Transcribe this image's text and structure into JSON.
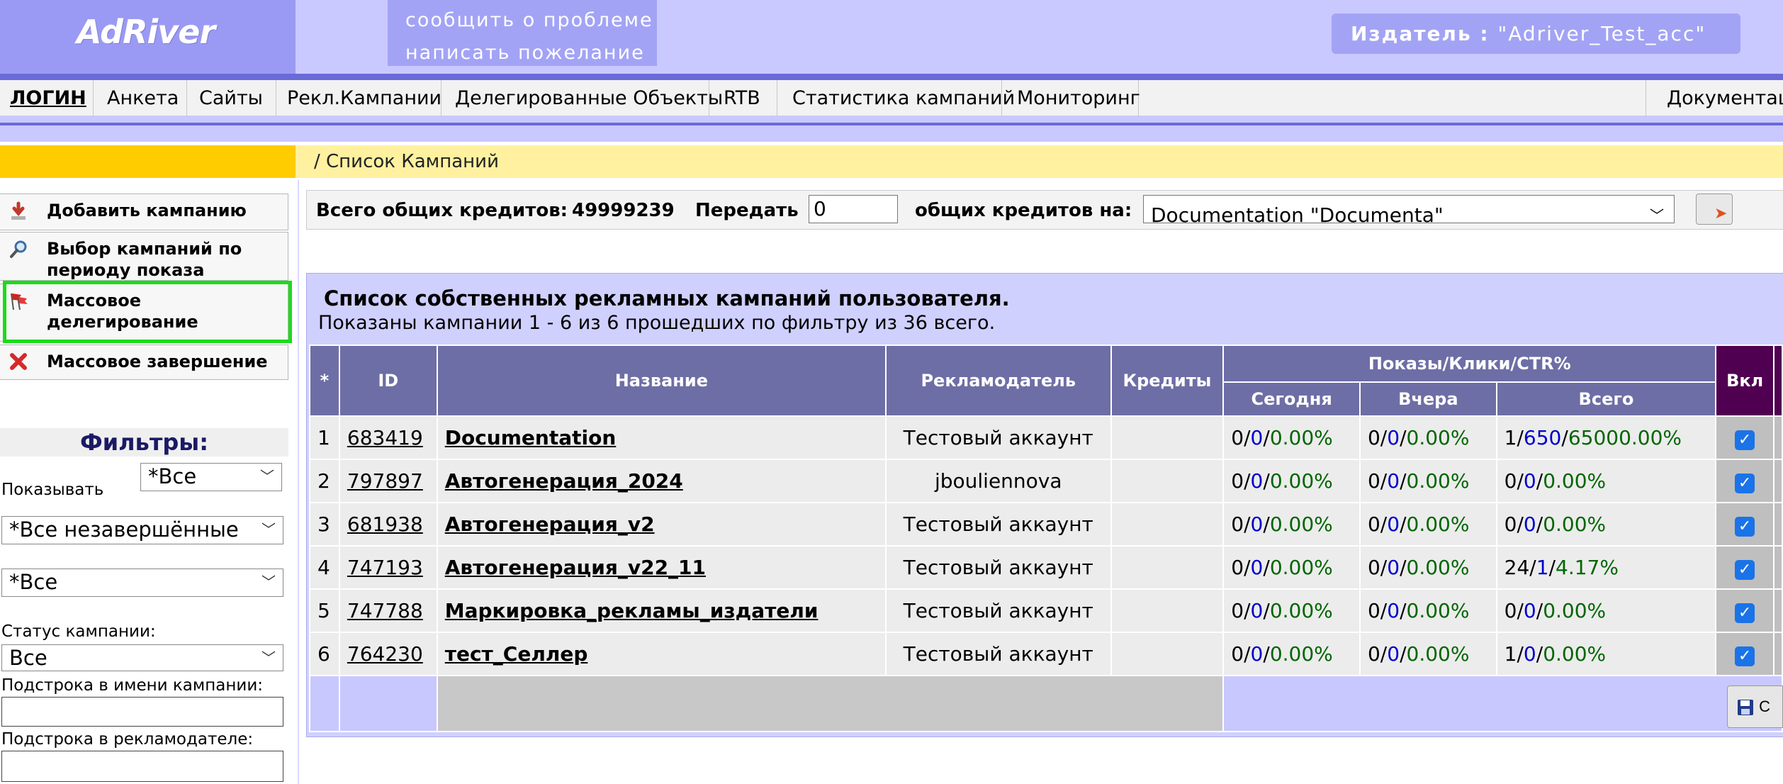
{
  "header": {
    "logo": "AdRiver",
    "feedback": [
      "сообщить о проблеме",
      "написать пожелание"
    ],
    "publisher_label": "Издатель  :",
    "publisher_value": "\"Adriver_Test_acc\""
  },
  "nav": {
    "items": [
      "ЛОГИН",
      "Анкета",
      "Сайты",
      "Рекл.Кампании",
      "Делегированные Объекты",
      "RTB",
      "Статистика кампаний",
      "Мониторинг"
    ],
    "right": "Документаци"
  },
  "breadcrumb": "/ Список Кампаний",
  "sidebar": {
    "buttons": [
      {
        "label": "Добавить кампанию",
        "icon": "download-arrow-icon"
      },
      {
        "label": "Выбор кампаний по периоду показа",
        "icon": "magnifier-icon"
      },
      {
        "label": "Массовое делегирование",
        "icon": "flags-icon"
      },
      {
        "label": "Массовое завершение",
        "icon": "red-x-icon"
      }
    ],
    "filters": {
      "title": "Фильтры:",
      "show_label": "Показывать",
      "show_value": "*Все",
      "state_value": "*Все незавершённые",
      "type_value": "*Все",
      "status_label": "Статус кампании:",
      "status_value": "Все",
      "name_substring_label": "Подстрока в имени кампании:",
      "name_substring_value": "",
      "advertiser_substring_label": "Подстрока в рекламодателе:",
      "advertiser_substring_value": ""
    }
  },
  "credits": {
    "total_label": "Всего общих кредитов:",
    "total_value": "49999239",
    "transfer_label": "Передать",
    "transfer_value": "0",
    "to_label": "общих кредитов  на:",
    "target_value": "Documentation \"Documenta\""
  },
  "campaigns": {
    "title": "Список собственных рекламных кампаний пользователя.",
    "subtitle": "Показаны кампании 1 - 6 из 6 прошедших по фильтру из 36 всего.",
    "columns": {
      "star": "*",
      "id": "ID",
      "name": "Название",
      "advertiser": "Рекламодатель",
      "credits": "Кредиты",
      "stats": "Показы/Клики/CTR%",
      "today": "Сегодня",
      "yesterday": "Вчера",
      "total": "Всего",
      "enabled": "Вкл"
    },
    "rows": [
      {
        "n": "1",
        "id": "683419",
        "name": "Documentation",
        "advertiser": "Тестовый аккаунт",
        "credits": "",
        "today": [
          "0",
          "0",
          "0.00%"
        ],
        "yesterday": [
          "0",
          "0",
          "0.00%"
        ],
        "total": [
          "1",
          "650",
          "65000.00%"
        ],
        "enabled": true
      },
      {
        "n": "2",
        "id": "797897",
        "name": "Автогенерация_2024",
        "advertiser": "jbouliennova",
        "credits": "",
        "today": [
          "0",
          "0",
          "0.00%"
        ],
        "yesterday": [
          "0",
          "0",
          "0.00%"
        ],
        "total": [
          "0",
          "0",
          "0.00%"
        ],
        "enabled": true
      },
      {
        "n": "3",
        "id": "681938",
        "name": "Автогенерация_v2",
        "advertiser": "Тестовый аккаунт",
        "credits": "",
        "today": [
          "0",
          "0",
          "0.00%"
        ],
        "yesterday": [
          "0",
          "0",
          "0.00%"
        ],
        "total": [
          "0",
          "0",
          "0.00%"
        ],
        "enabled": true
      },
      {
        "n": "4",
        "id": "747193",
        "name": "Автогенерация_v22_11",
        "advertiser": "Тестовый аккаунт",
        "credits": "",
        "today": [
          "0",
          "0",
          "0.00%"
        ],
        "yesterday": [
          "0",
          "0",
          "0.00%"
        ],
        "total": [
          "24",
          "1",
          "4.17%"
        ],
        "enabled": true
      },
      {
        "n": "5",
        "id": "747788",
        "name": "Маркировка_рекламы_издатели",
        "advertiser": "Тестовый аккаунт",
        "credits": "",
        "today": [
          "0",
          "0",
          "0.00%"
        ],
        "yesterday": [
          "0",
          "0",
          "0.00%"
        ],
        "total": [
          "0",
          "0",
          "0.00%"
        ],
        "enabled": true
      },
      {
        "n": "6",
        "id": "764230",
        "name": "тест_Селлер",
        "advertiser": "Тестовый аккаунт",
        "credits": "",
        "today": [
          "0",
          "0",
          "0.00%"
        ],
        "yesterday": [
          "0",
          "0",
          "0.00%"
        ],
        "total": [
          "1",
          "0",
          "0.00%"
        ],
        "enabled": true
      }
    ],
    "save_label": "С"
  }
}
